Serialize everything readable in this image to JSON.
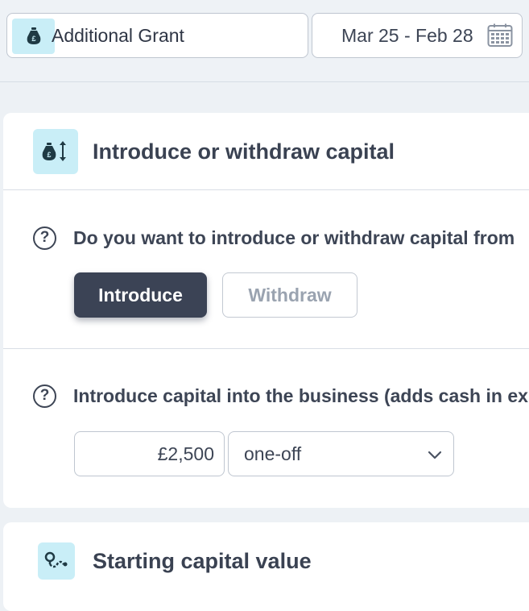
{
  "topbar": {
    "grant": {
      "label": "Additional Grant",
      "icon": "money-bag-pound-icon"
    },
    "date_range": {
      "label": "Mar 25 - Feb 28",
      "icon": "calendar-icon"
    }
  },
  "capital_section": {
    "title": "Introduce or withdraw capital",
    "icon": "money-bag-arrows-icon",
    "question1": {
      "text": "Do you want to introduce or withdraw capital from",
      "icon": "question-circle-icon",
      "help_glyph": "?"
    },
    "options": {
      "introduce_label": "Introduce",
      "withdraw_label": "Withdraw",
      "selected": "Introduce"
    },
    "question2": {
      "text": "Introduce capital into the business (adds cash in ex",
      "icon": "question-circle-icon",
      "help_glyph": "?"
    },
    "amount": {
      "value": "£2,500"
    },
    "frequency": {
      "value": "one-off",
      "icon": "chevron-down-icon"
    }
  },
  "starting_section": {
    "title": "Starting capital value",
    "icon": "trend-line-icon"
  },
  "colors": {
    "accent_bg": "#c9eef7",
    "primary_button": "#3b4355",
    "page_bg": "#edf1f5",
    "text": "#3d4555"
  }
}
